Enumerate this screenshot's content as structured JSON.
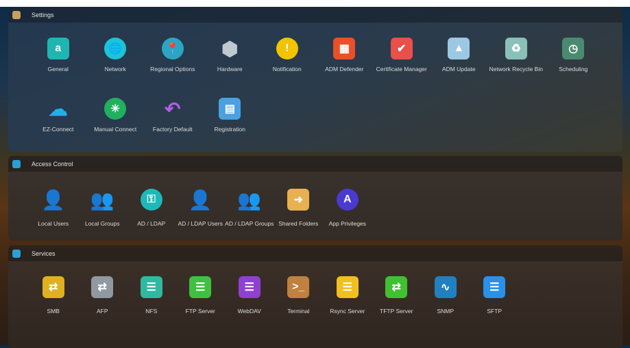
{
  "sections": [
    {
      "title": "Settings",
      "icon": "settings-gear-icon",
      "icon_color": "#c8a060",
      "icon_glyph": "⚙",
      "items": [
        {
          "label": "General",
          "icon": "general-icon",
          "color": "#1fb5b0",
          "glyph": "a",
          "shape": "sq"
        },
        {
          "label": "Network",
          "icon": "network-globe-icon",
          "color": "#1cc4d6",
          "glyph": "🌐",
          "shape": "circ"
        },
        {
          "label": "Regional Options",
          "icon": "regional-options-icon",
          "color": "#2aa6c4",
          "glyph": "📍",
          "shape": "circ"
        },
        {
          "label": "Hardware",
          "icon": "hardware-nut-icon",
          "color": "#c0c8d0",
          "glyph": "⬢",
          "shape": "none"
        },
        {
          "label": "Notification",
          "icon": "notification-icon",
          "color": "#f2c400",
          "glyph": "!",
          "shape": "circ"
        },
        {
          "label": "ADM Defender",
          "icon": "adm-defender-icon",
          "color": "#e8502a",
          "glyph": "▦",
          "shape": "sq"
        },
        {
          "label": "Certificate Manager",
          "icon": "certificate-manager-icon",
          "color": "#e8504a",
          "glyph": "✔",
          "shape": "sq"
        },
        {
          "label": "ADM Update",
          "icon": "adm-update-icon",
          "color": "#9cc8e4",
          "glyph": "▲",
          "shape": "sq"
        },
        {
          "label": "Network Recycle Bin",
          "icon": "recycle-bin-icon",
          "color": "#8ac0b8",
          "glyph": "♻",
          "shape": "sq"
        },
        {
          "label": "Scheduling",
          "icon": "scheduling-icon",
          "color": "#4a8a70",
          "glyph": "◷",
          "shape": "sq"
        },
        {
          "label": "EZ-Connect",
          "icon": "ez-connect-cloud-icon",
          "color": "#20b0e8",
          "glyph": "☁",
          "shape": "none"
        },
        {
          "label": "Manual Connect",
          "icon": "manual-connect-icon",
          "color": "#20b060",
          "glyph": "✳",
          "shape": "circ"
        },
        {
          "label": "Factory Default",
          "icon": "factory-default-icon",
          "color": "#b060e0",
          "glyph": "↶",
          "shape": "none"
        },
        {
          "label": "Registration",
          "icon": "registration-icon",
          "color": "#4aa0e0",
          "glyph": "▤",
          "shape": "sq"
        }
      ]
    },
    {
      "title": "Access Control",
      "icon": "access-control-icon",
      "icon_color": "#2aa0d8",
      "icon_glyph": "▣",
      "items": [
        {
          "label": "Local Users",
          "icon": "local-users-icon",
          "color": "#2a90e0",
          "glyph": "👤",
          "shape": "none"
        },
        {
          "label": "Local Groups",
          "icon": "local-groups-icon",
          "color": "#2a90e0",
          "glyph": "👥",
          "shape": "none"
        },
        {
          "label": "AD / LDAP",
          "icon": "ad-ldap-key-icon",
          "color": "#1fb8b8",
          "glyph": "⚿",
          "shape": "circ"
        },
        {
          "label": "AD / LDAP Users",
          "icon": "ad-ldap-users-icon",
          "color": "#f08a20",
          "glyph": "👤",
          "shape": "none"
        },
        {
          "label": "AD / LDAP Groups",
          "icon": "ad-ldap-groups-icon",
          "color": "#f08a20",
          "glyph": "👥",
          "shape": "none"
        },
        {
          "label": "Shared Folders",
          "icon": "shared-folders-icon",
          "color": "#e8b050",
          "glyph": "➜",
          "shape": "sq"
        },
        {
          "label": "App Privileges",
          "icon": "app-privileges-icon",
          "color": "#4a3ad0",
          "glyph": "A",
          "shape": "circ"
        }
      ]
    },
    {
      "title": "Services",
      "icon": "services-icon",
      "icon_color": "#2aa0d8",
      "icon_glyph": "♪",
      "items": [
        {
          "label": "SMB",
          "icon": "smb-icon",
          "color": "#e0b020",
          "glyph": "⇄",
          "shape": "sq"
        },
        {
          "label": "AFP",
          "icon": "afp-icon",
          "color": "#9098a0",
          "glyph": "⇄",
          "shape": "sq"
        },
        {
          "label": "NFS",
          "icon": "nfs-icon",
          "color": "#30b8a0",
          "glyph": "☰",
          "shape": "sq"
        },
        {
          "label": "FTP Server",
          "icon": "ftp-server-icon",
          "color": "#40c040",
          "glyph": "☰",
          "shape": "sq"
        },
        {
          "label": "WebDAV",
          "icon": "webdav-icon",
          "color": "#9040d0",
          "glyph": "☰",
          "shape": "sq"
        },
        {
          "label": "Terminal",
          "icon": "terminal-icon",
          "color": "#c08040",
          "glyph": ">_",
          "shape": "sq"
        },
        {
          "label": "Rsync Server",
          "icon": "rsync-server-icon",
          "color": "#f0c020",
          "glyph": "☰",
          "shape": "sq"
        },
        {
          "label": "TFTP Server",
          "icon": "tftp-server-icon",
          "color": "#40c030",
          "glyph": "⇄",
          "shape": "sq"
        },
        {
          "label": "SNMP",
          "icon": "snmp-monitor-icon",
          "color": "#2080c0",
          "glyph": "∿",
          "shape": "sq"
        },
        {
          "label": "SFTP",
          "icon": "sftp-icon",
          "color": "#2a90e8",
          "glyph": "☰",
          "shape": "sq"
        }
      ]
    }
  ]
}
